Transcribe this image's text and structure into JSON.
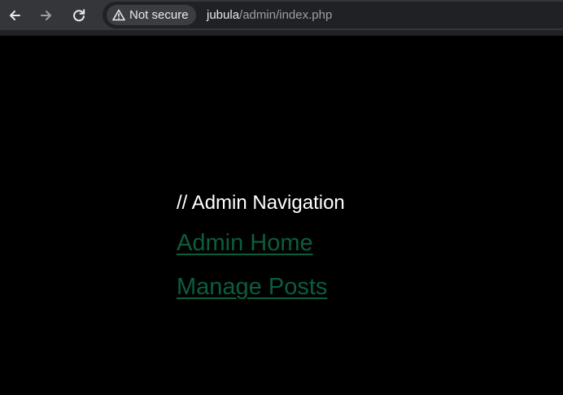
{
  "browser": {
    "back_icon": "arrow-left-icon",
    "forward_icon": "arrow-right-icon",
    "reload_icon": "reload-icon",
    "security_icon": "warning-triangle-icon",
    "security_label": "Not secure",
    "url_host": "jubula",
    "url_path": "/admin/index.php",
    "toolbar_color": "#35363a",
    "omnibox_color": "#202124"
  },
  "page": {
    "background": "#000000",
    "heading": "// Admin Navigation",
    "links": [
      {
        "label": "Admin Home"
      },
      {
        "label": "Manage Posts"
      }
    ],
    "link_color": "#0b5d3e"
  }
}
